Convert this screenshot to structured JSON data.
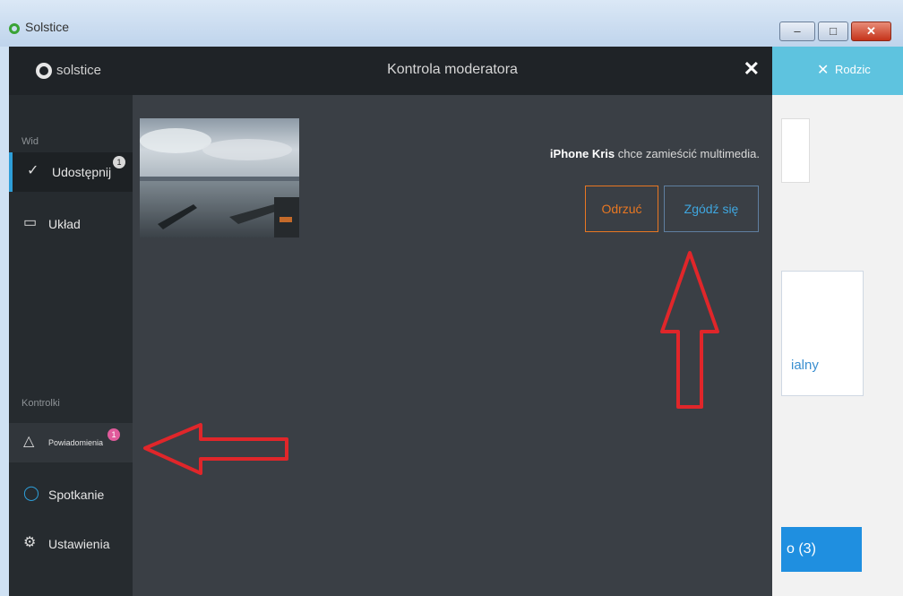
{
  "window": {
    "title": "Solstice"
  },
  "sidebar": {
    "brand": "solstice",
    "section_view": "Wid",
    "items": [
      {
        "label": "Udostępnij",
        "icon": "share-icon",
        "badge": "1"
      },
      {
        "label": "Układ",
        "icon": "layout-icon"
      }
    ],
    "section_controls": "Kontrolki",
    "control_items": [
      {
        "label": "Powiadomienia",
        "icon": "alert-icon",
        "badge": "1"
      },
      {
        "label": "Spotkanie",
        "icon": "meeting-icon"
      },
      {
        "label": "Ustawienia",
        "icon": "gear-icon"
      }
    ]
  },
  "modal": {
    "title": "Kontrola moderatora",
    "request_user": "iPhone Kris",
    "request_text": "chce zamieścić multimedia.",
    "reject_label": "Odrzuć",
    "accept_label": "Zgódź się"
  },
  "background_window": {
    "header_text": "Rodzic",
    "card_text": "ialny",
    "button_text": "o (3)"
  },
  "colors": {
    "accent": "#2e9ed8",
    "reject": "#e87722",
    "badge": "#e05b9b",
    "arrow": "#e0262a"
  }
}
